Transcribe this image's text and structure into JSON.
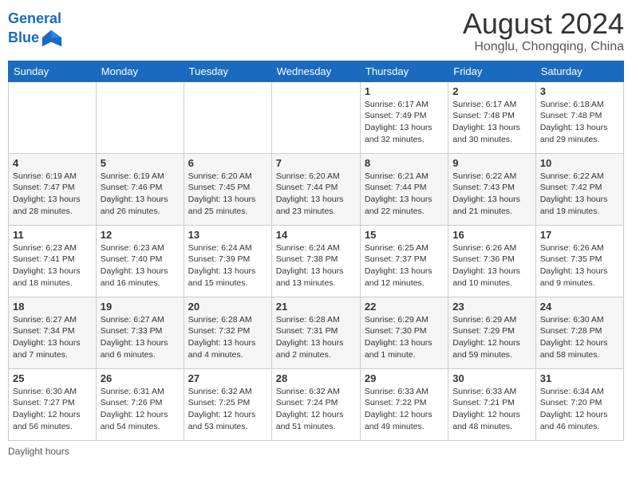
{
  "header": {
    "logo_line1": "General",
    "logo_line2": "Blue",
    "title": "August 2024",
    "subtitle": "Honglu, Chongqing, China"
  },
  "weekdays": [
    "Sunday",
    "Monday",
    "Tuesday",
    "Wednesday",
    "Thursday",
    "Friday",
    "Saturday"
  ],
  "weeks": [
    [
      {
        "day": "",
        "info": ""
      },
      {
        "day": "",
        "info": ""
      },
      {
        "day": "",
        "info": ""
      },
      {
        "day": "",
        "info": ""
      },
      {
        "day": "1",
        "info": "Sunrise: 6:17 AM\nSunset: 7:49 PM\nDaylight: 13 hours\nand 32 minutes."
      },
      {
        "day": "2",
        "info": "Sunrise: 6:17 AM\nSunset: 7:48 PM\nDaylight: 13 hours\nand 30 minutes."
      },
      {
        "day": "3",
        "info": "Sunrise: 6:18 AM\nSunset: 7:48 PM\nDaylight: 13 hours\nand 29 minutes."
      }
    ],
    [
      {
        "day": "4",
        "info": "Sunrise: 6:19 AM\nSunset: 7:47 PM\nDaylight: 13 hours\nand 28 minutes."
      },
      {
        "day": "5",
        "info": "Sunrise: 6:19 AM\nSunset: 7:46 PM\nDaylight: 13 hours\nand 26 minutes."
      },
      {
        "day": "6",
        "info": "Sunrise: 6:20 AM\nSunset: 7:45 PM\nDaylight: 13 hours\nand 25 minutes."
      },
      {
        "day": "7",
        "info": "Sunrise: 6:20 AM\nSunset: 7:44 PM\nDaylight: 13 hours\nand 23 minutes."
      },
      {
        "day": "8",
        "info": "Sunrise: 6:21 AM\nSunset: 7:44 PM\nDaylight: 13 hours\nand 22 minutes."
      },
      {
        "day": "9",
        "info": "Sunrise: 6:22 AM\nSunset: 7:43 PM\nDaylight: 13 hours\nand 21 minutes."
      },
      {
        "day": "10",
        "info": "Sunrise: 6:22 AM\nSunset: 7:42 PM\nDaylight: 13 hours\nand 19 minutes."
      }
    ],
    [
      {
        "day": "11",
        "info": "Sunrise: 6:23 AM\nSunset: 7:41 PM\nDaylight: 13 hours\nand 18 minutes."
      },
      {
        "day": "12",
        "info": "Sunrise: 6:23 AM\nSunset: 7:40 PM\nDaylight: 13 hours\nand 16 minutes."
      },
      {
        "day": "13",
        "info": "Sunrise: 6:24 AM\nSunset: 7:39 PM\nDaylight: 13 hours\nand 15 minutes."
      },
      {
        "day": "14",
        "info": "Sunrise: 6:24 AM\nSunset: 7:38 PM\nDaylight: 13 hours\nand 13 minutes."
      },
      {
        "day": "15",
        "info": "Sunrise: 6:25 AM\nSunset: 7:37 PM\nDaylight: 13 hours\nand 12 minutes."
      },
      {
        "day": "16",
        "info": "Sunrise: 6:26 AM\nSunset: 7:36 PM\nDaylight: 13 hours\nand 10 minutes."
      },
      {
        "day": "17",
        "info": "Sunrise: 6:26 AM\nSunset: 7:35 PM\nDaylight: 13 hours\nand 9 minutes."
      }
    ],
    [
      {
        "day": "18",
        "info": "Sunrise: 6:27 AM\nSunset: 7:34 PM\nDaylight: 13 hours\nand 7 minutes."
      },
      {
        "day": "19",
        "info": "Sunrise: 6:27 AM\nSunset: 7:33 PM\nDaylight: 13 hours\nand 6 minutes."
      },
      {
        "day": "20",
        "info": "Sunrise: 6:28 AM\nSunset: 7:32 PM\nDaylight: 13 hours\nand 4 minutes."
      },
      {
        "day": "21",
        "info": "Sunrise: 6:28 AM\nSunset: 7:31 PM\nDaylight: 13 hours\nand 2 minutes."
      },
      {
        "day": "22",
        "info": "Sunrise: 6:29 AM\nSunset: 7:30 PM\nDaylight: 13 hours\nand 1 minute."
      },
      {
        "day": "23",
        "info": "Sunrise: 6:29 AM\nSunset: 7:29 PM\nDaylight: 12 hours\nand 59 minutes."
      },
      {
        "day": "24",
        "info": "Sunrise: 6:30 AM\nSunset: 7:28 PM\nDaylight: 12 hours\nand 58 minutes."
      }
    ],
    [
      {
        "day": "25",
        "info": "Sunrise: 6:30 AM\nSunset: 7:27 PM\nDaylight: 12 hours\nand 56 minutes."
      },
      {
        "day": "26",
        "info": "Sunrise: 6:31 AM\nSunset: 7:26 PM\nDaylight: 12 hours\nand 54 minutes."
      },
      {
        "day": "27",
        "info": "Sunrise: 6:32 AM\nSunset: 7:25 PM\nDaylight: 12 hours\nand 53 minutes."
      },
      {
        "day": "28",
        "info": "Sunrise: 6:32 AM\nSunset: 7:24 PM\nDaylight: 12 hours\nand 51 minutes."
      },
      {
        "day": "29",
        "info": "Sunrise: 6:33 AM\nSunset: 7:22 PM\nDaylight: 12 hours\nand 49 minutes."
      },
      {
        "day": "30",
        "info": "Sunrise: 6:33 AM\nSunset: 7:21 PM\nDaylight: 12 hours\nand 48 minutes."
      },
      {
        "day": "31",
        "info": "Sunrise: 6:34 AM\nSunset: 7:20 PM\nDaylight: 12 hours\nand 46 minutes."
      }
    ]
  ],
  "footer": {
    "label": "Daylight hours"
  }
}
